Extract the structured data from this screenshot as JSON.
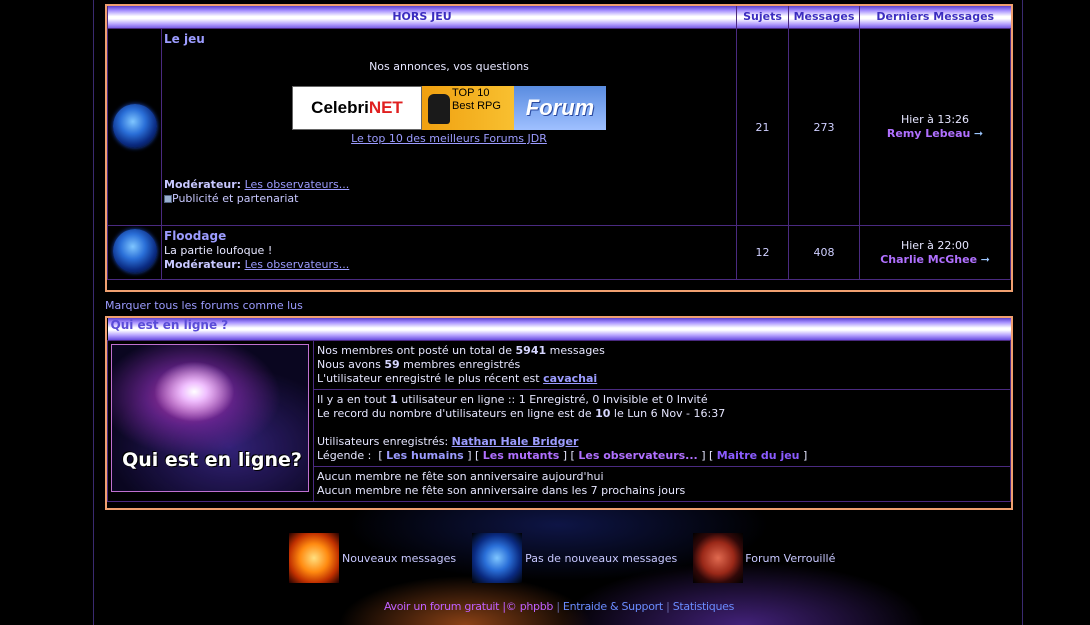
{
  "forum_table": {
    "headers": {
      "section": "HORS JEU",
      "topics": "Sujets",
      "posts": "Messages",
      "last": "Derniers Messages"
    },
    "rows": [
      {
        "title": "Le jeu",
        "description": "Nos annonces, vos questions",
        "banners": {
          "celebrinet_a": "Celebri",
          "celebrinet_b": "NET",
          "top10": "TOP 10 Best RPG",
          "forum": "Forum"
        },
        "top10_link": "Le top 10 des meilleurs Forums JDR",
        "moderator_label": "Modérateur:",
        "moderator": "Les observateurs...",
        "subforum": "Publicité et partenariat",
        "topics": "21",
        "posts": "273",
        "last_date": "Hier à 13:26",
        "last_user": "Remy Lebeau"
      },
      {
        "title": "Floodage",
        "description": "La partie loufoque !",
        "moderator_label": "Modérateur:",
        "moderator": "Les observateurs...",
        "topics": "12",
        "posts": "408",
        "last_date": "Hier à 22:00",
        "last_user": "Charlie McGhee"
      }
    ]
  },
  "mark_read": "Marquer tous les forums comme lus",
  "who_online": {
    "title": "Qui est en ligne ?",
    "image_text": "Qui est en ligne?",
    "stats": {
      "l1a": "Nos membres ont posté un total de",
      "total_posts": "5941",
      "l1b": "messages",
      "l2a": "Nous avons",
      "members": "59",
      "l2b": "membres enregistrés",
      "l3": "L'utilisateur enregistré le plus récent est",
      "newest": "cavachai"
    },
    "online": {
      "l1a": "Il y a en tout",
      "count": "1",
      "l1b": "utilisateur en ligne :: 1 Enregistré, 0 Invisible et 0 Invité",
      "l2a": "Le record du nombre d'utilisateurs en ligne est de",
      "record": "10",
      "l2b": "le Lun 6 Nov - 16:37",
      "registered_label": "Utilisateurs enregistrés:",
      "registered_user": "Nathan Hale Bridger",
      "legend_label": "Légende :",
      "groups": [
        "Les humains",
        "Les mutants",
        "Les observateurs...",
        "Maitre du jeu"
      ]
    },
    "birthdays": {
      "today": "Aucun membre ne fête son anniversaire aujourd'hui",
      "week": "Aucun membre ne fête son anniversaire dans les 7 prochains jours"
    }
  },
  "icon_legend": {
    "new": "Nouveaux messages",
    "none": "Pas de nouveaux messages",
    "locked": "Forum Verrouillé"
  },
  "footer": {
    "free_forum": "Avoir un forum gratuit",
    "pipe": "|",
    "copyright": "© phpbb",
    "support": "Entraide & Support",
    "stats": "Statistiques"
  }
}
